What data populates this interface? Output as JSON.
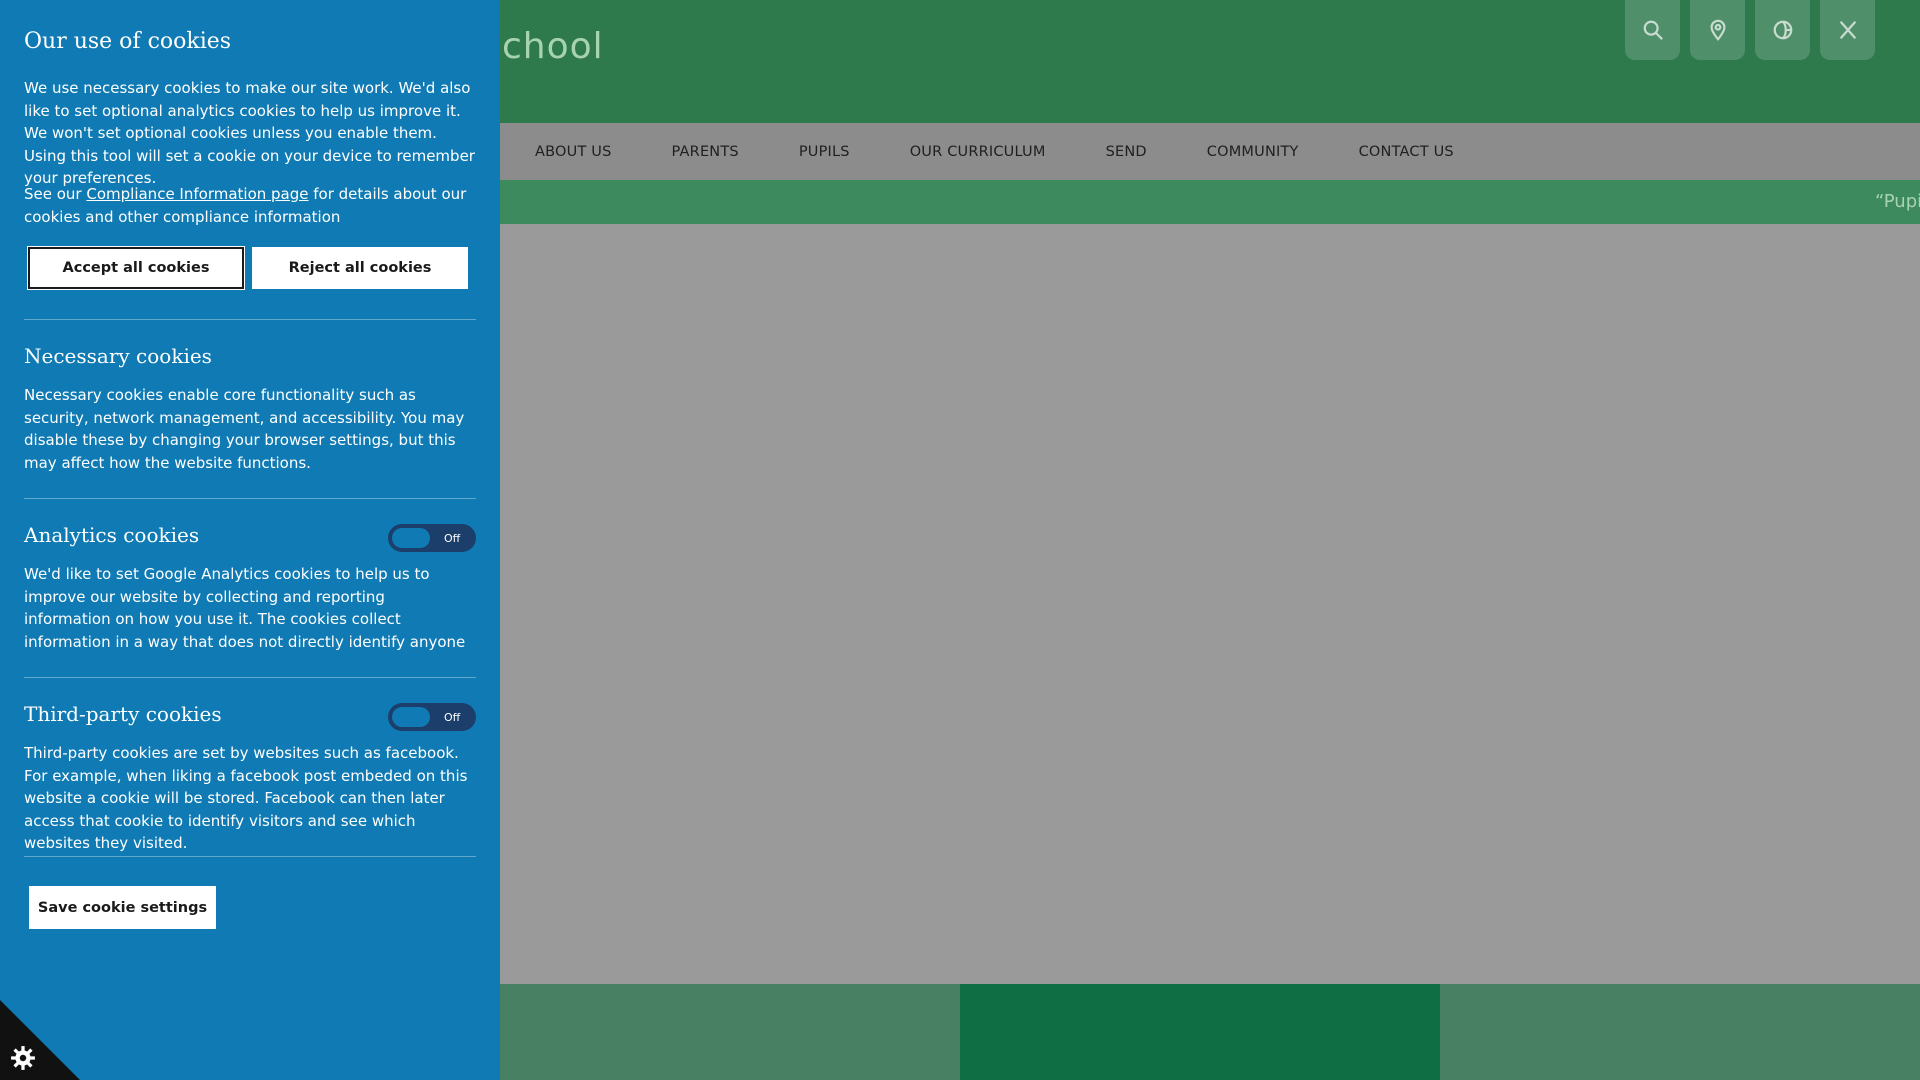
{
  "site": {
    "title_fragment": "chool",
    "header_icons": [
      {
        "name": "search-icon"
      },
      {
        "name": "location-pin-icon"
      },
      {
        "name": "translate-icon"
      },
      {
        "name": "x-twitter-icon"
      }
    ],
    "nav": [
      {
        "label": "ABOUT US"
      },
      {
        "label": "PARENTS"
      },
      {
        "label": "PUPILS"
      },
      {
        "label": "OUR CURRICULUM"
      },
      {
        "label": "SEND"
      },
      {
        "label": "COMMUNITY"
      },
      {
        "label": "CONTACT US"
      }
    ],
    "ticker_text": "“Pupi"
  },
  "cookies": {
    "title": "Our use of cookies",
    "intro": "We use necessary cookies to make our site work. We'd also like to set optional analytics cookies to help us improve it. We won't set optional cookies unless you enable them. Using this tool will set a cookie on your device to remember your preferences.",
    "see_our": "See our ",
    "compliance_link": "Compliance Information page",
    "compliance_rest": " for details about our cookies and other compliance information",
    "accept_all": "Accept all cookies",
    "reject_all": "Reject all cookies",
    "necessary": {
      "title": "Necessary cookies",
      "body": "Necessary cookies enable core functionality such as security, network management, and accessibility. You may disable these by changing your browser settings, but this may affect how the website functions."
    },
    "analytics": {
      "title": "Analytics cookies",
      "toggle_state": "Off",
      "body": "We'd like to set Google Analytics cookies to help us to improve our website by collecting and reporting information on how you use it. The cookies collect information in a way that does not directly identify anyone"
    },
    "third_party": {
      "title": "Third-party cookies",
      "toggle_state": "Off",
      "body": "Third-party cookies are set by websites such as facebook. For example, when liking a facebook post embeded on this website a cookie will be stored. Facebook can then later access that cookie to identify visitors and see which websites they visited."
    },
    "save": "Save cookie settings"
  },
  "colors": {
    "panel_bg": "#0f7ab3",
    "header_green": "#2e7a4d",
    "toggle_track": "#1b3e6b"
  }
}
